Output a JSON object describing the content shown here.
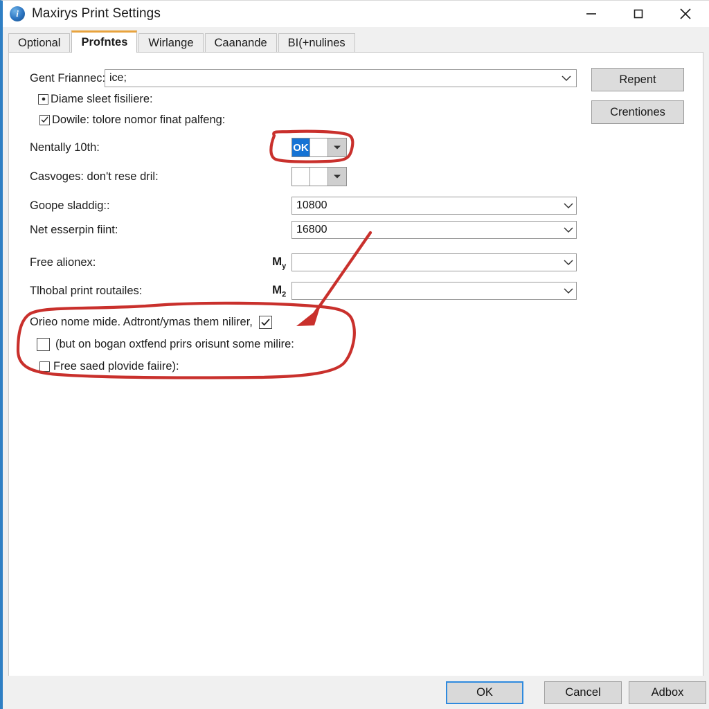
{
  "window": {
    "title": "Maxirys Print Settings",
    "icon": "info-circle-icon",
    "minimize": "─",
    "maximize": "□",
    "close": "✕",
    "border_accent": "#2f7fc4"
  },
  "tabs": [
    {
      "label": "Optional",
      "active": false
    },
    {
      "label": "Profntes",
      "active": true
    },
    {
      "label": "Wirlange",
      "active": false
    },
    {
      "label": "Caanande",
      "active": false
    },
    {
      "label": "BI(+nulines",
      "active": false
    }
  ],
  "form": {
    "rows": [
      {
        "label": "Gent Friannec:",
        "value": "ice;",
        "control": "textbox"
      },
      {
        "label": "Diame sleet fisiliere:",
        "control": "checkbox",
        "checked": true
      },
      {
        "label": "Dowile: tolore nomor finat palfeng:",
        "control": "checkbox",
        "checked": true
      },
      {
        "label": "Nentally 10th:",
        "control": "minicombo",
        "value": "OK",
        "highlighted": true
      },
      {
        "label": "Casvoges: don't rese dril:",
        "control": "minicombo",
        "value": ""
      },
      {
        "label": "Goope sladdig::",
        "control": "combo",
        "value": "10800"
      },
      {
        "label": "Net esserpin fiint:",
        "control": "combo",
        "value": "16800"
      },
      {
        "label": "Free alionex:",
        "control": "combo",
        "value": "",
        "prefix": "M",
        "prefix_sub": "y"
      },
      {
        "label": "Tlhobal print routailes:",
        "control": "combo",
        "value": "",
        "prefix": "M",
        "prefix_sub": "2"
      }
    ],
    "checkbox_group": [
      {
        "label": "Orieo nome mide. Adtront/ymas them nilirer,",
        "checked": true,
        "box_after": true
      },
      {
        "label": "(but on bogan oxtfend prirs orisunt some milire:",
        "checked": false,
        "box_after": false
      },
      {
        "label": "Free saed plovide faiire):",
        "checked": false,
        "box_after": false
      }
    ]
  },
  "side_buttons": [
    {
      "label": "Repent"
    },
    {
      "label": "Crentiones"
    }
  ],
  "footer_buttons": [
    {
      "label": "OK",
      "focused": true
    },
    {
      "label": "Cancel",
      "focused": false
    },
    {
      "label": "Adbox",
      "focused": false
    }
  ],
  "annotations": {
    "color": "#c9302c",
    "items": [
      {
        "name": "highlight-ellipse-mini-combo"
      },
      {
        "name": "highlight-ellipse-checkbox-group"
      },
      {
        "name": "pointer-arrow-to-checkbox-group"
      }
    ]
  }
}
